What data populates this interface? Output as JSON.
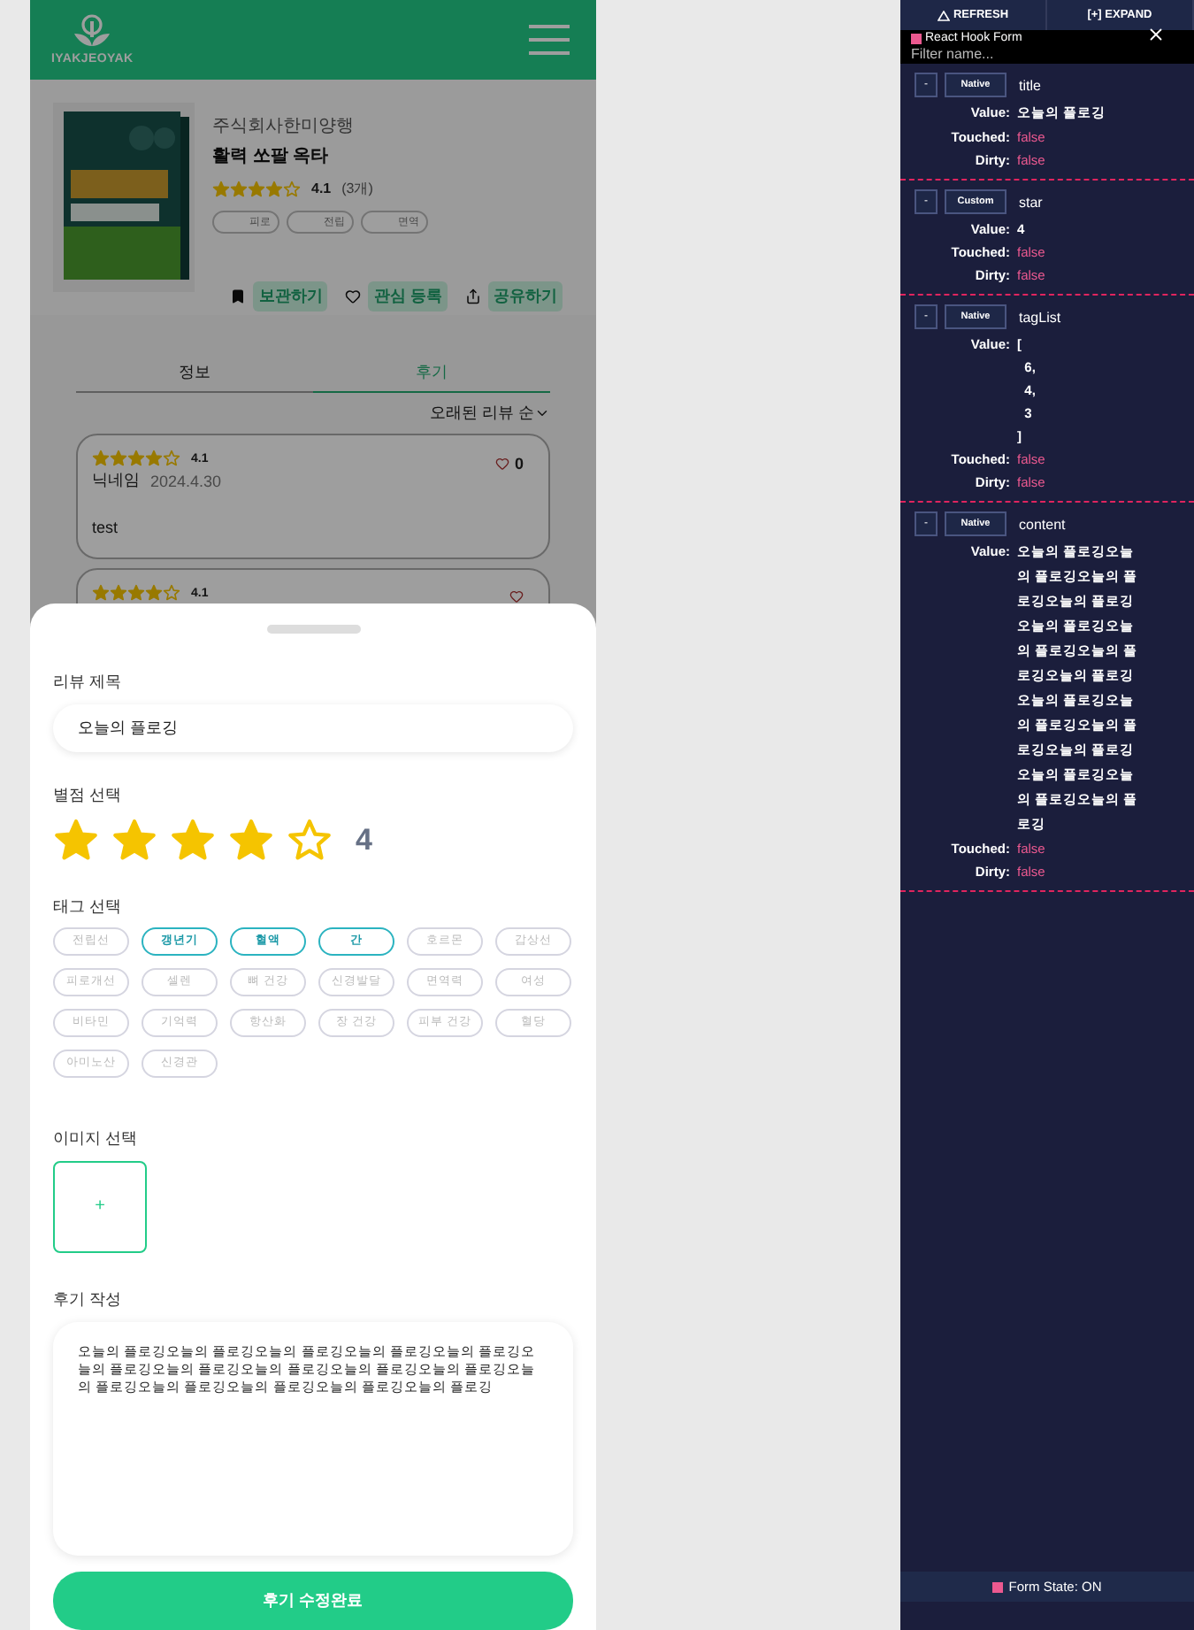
{
  "app": {
    "logo_text": "IYAKJEOYAK",
    "product": {
      "company": "주식회사한미양행",
      "name": "활력 쏘팔 옥타",
      "stars": 4,
      "rating": "4.1",
      "count": "(3개)",
      "tags": [
        "피로",
        "전립",
        "면역"
      ],
      "actions": [
        {
          "kind": "bookmark",
          "label": "보관하기"
        },
        {
          "kind": "heart",
          "label": "관심 등록"
        },
        {
          "kind": "share",
          "label": "공유하기"
        }
      ]
    },
    "tabs": [
      {
        "label": "정보",
        "selected": false
      },
      {
        "label": "후기",
        "selected": true
      }
    ],
    "sort": "오래된 리뷰 순",
    "reviews": [
      {
        "stars": 4,
        "rating": "4.1",
        "author": "닉네임",
        "date": "2024.4.30",
        "likes": "0",
        "body": "test"
      },
      {
        "stars": 4,
        "rating": "4.1"
      }
    ]
  },
  "sheet": {
    "title_label": "리뷰 제목",
    "title_value": "오늘의 플로깅",
    "rating_label": "별점 선택",
    "stars": 4,
    "rating_value": "4",
    "tags_label": "태그 선택",
    "tags": [
      {
        "label": "전립선",
        "selected": false
      },
      {
        "label": "갱년기",
        "selected": true
      },
      {
        "label": "혈액",
        "selected": true
      },
      {
        "label": "간",
        "selected": true
      },
      {
        "label": "호르몬",
        "selected": false
      },
      {
        "label": "갑상선",
        "selected": false
      },
      {
        "label": "피로개선",
        "selected": false
      },
      {
        "label": "셀렌",
        "selected": false
      },
      {
        "label": "뼈 건강",
        "selected": false
      },
      {
        "label": "신경발달",
        "selected": false
      },
      {
        "label": "면역력",
        "selected": false
      },
      {
        "label": "여성",
        "selected": false
      },
      {
        "label": "비타민",
        "selected": false
      },
      {
        "label": "기억력",
        "selected": false
      },
      {
        "label": "항산화",
        "selected": false
      },
      {
        "label": "장 건강",
        "selected": false
      },
      {
        "label": "피부 건강",
        "selected": false
      },
      {
        "label": "혈당",
        "selected": false
      },
      {
        "label": "아미노산",
        "selected": false
      },
      {
        "label": "신경관",
        "selected": false
      }
    ],
    "image_label": "이미지 선택",
    "add_image": "+",
    "content_label": "후기 작성",
    "content_value": "오늘의 플로깅오늘의 플로깅오늘의 플로깅오늘의 플로깅오늘의 플로깅오늘의 플로깅오늘의 플로깅오늘의 플로깅오늘의 플로깅오늘의 플로깅오늘의 플로깅오늘의 플로깅오늘의 플로깅오늘의 플로깅오늘의 플로깅",
    "submit": "후기 수정완료"
  },
  "devtools": {
    "refresh": "REFRESH",
    "expand": "[+] EXPAND",
    "title": "React Hook Form",
    "filter_placeholder": "Filter name...",
    "fields": [
      {
        "toggle": "-",
        "kind": "Native",
        "name": "title",
        "rows": [
          {
            "kind": "value",
            "label": "Value:",
            "lines": [
              "오늘의 플로깅"
            ]
          },
          {
            "kind": "flag",
            "label": "Touched:",
            "value": "false"
          },
          {
            "kind": "flag",
            "label": "Dirty:",
            "value": "false"
          }
        ]
      },
      {
        "toggle": "-",
        "kind": "Custom",
        "name": "star",
        "rows": [
          {
            "kind": "value",
            "label": "Value:",
            "lines": [
              "4"
            ]
          },
          {
            "kind": "flag",
            "label": "Touched:",
            "value": "false"
          },
          {
            "kind": "flag",
            "label": "Dirty:",
            "value": "false"
          }
        ]
      },
      {
        "toggle": "-",
        "kind": "Native",
        "name": "tagList",
        "rows": [
          {
            "kind": "value",
            "label": "Value:",
            "lines": [
              "[",
              "  6,",
              "  4,",
              "  3",
              "]"
            ]
          },
          {
            "kind": "flag",
            "label": "Touched:",
            "value": "false"
          },
          {
            "kind": "flag",
            "label": "Dirty:",
            "value": "false"
          }
        ]
      },
      {
        "toggle": "-",
        "kind": "Native",
        "name": "content",
        "rows": [
          {
            "kind": "value",
            "label": "Value:",
            "lines": [
              "오늘의 플로깅오늘",
              "의 플로깅오늘의 플",
              "로깅오늘의 플로깅",
              "오늘의 플로깅오늘",
              "의 플로깅오늘의 플",
              "로깅오늘의 플로깅",
              "오늘의 플로깅오늘",
              "의 플로깅오늘의 플",
              "로깅오늘의 플로깅",
              "오늘의 플로깅오늘",
              "의 플로깅오늘의 플",
              "로깅"
            ]
          },
          {
            "kind": "flag",
            "label": "Touched:",
            "value": "false"
          },
          {
            "kind": "flag",
            "label": "Dirty:",
            "value": "false"
          }
        ]
      }
    ],
    "status": "Form State: ON"
  }
}
